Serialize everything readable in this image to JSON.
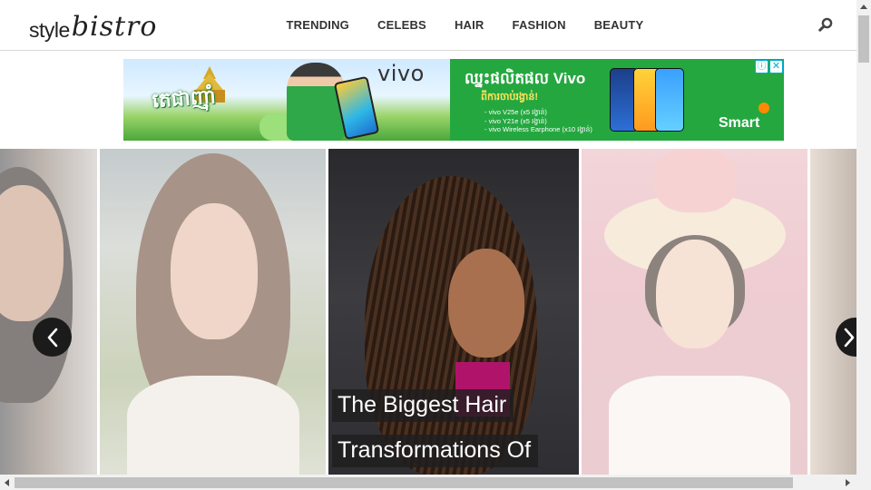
{
  "header": {
    "logo_style": "style",
    "logo_bistro": "bistro",
    "nav": [
      "TRENDING",
      "CELEBS",
      "HAIR",
      "FASHION",
      "BEAUTY"
    ]
  },
  "ad": {
    "brand": "vivo",
    "headline": "ឈ្នះផលិតផល Vivo",
    "subhead": "ពីការចាប់រង្វាន់!",
    "prizes": [
      "- vivo V25e (x5 រង្វាន់)",
      "- vivo Y21e (x5 រង្វាន់)",
      "- vivo Wireless Earphone (x10 រង្វាន់)"
    ],
    "left_title": "តេជាញ៉ាំ",
    "sponsor": "Smart",
    "info_icon": "ⓘ",
    "close_icon": "✕"
  },
  "carousel": {
    "caption_line1": "The Biggest Hair",
    "caption_line2": "Transformations Of"
  },
  "colors": {
    "ad_green": "#25a740",
    "caption_bg": "#1e1e1e",
    "arrow_bg": "#1b1b1b"
  }
}
